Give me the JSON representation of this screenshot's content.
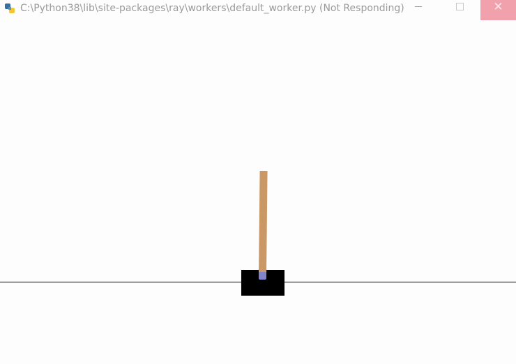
{
  "window": {
    "title": "C:\\Python38\\lib\\site-packages\\ray\\workers\\default_worker.py (Not Responding)",
    "app_icon": "python-icon",
    "controls": {
      "minimize_icon": "minimize-icon",
      "maximize_icon": "maximize-icon",
      "close_icon": "close-icon",
      "close_glyph": "✕"
    }
  },
  "scene": {
    "name": "cartpole",
    "colors": {
      "background": "#fdfdfd",
      "track": "#000000",
      "cart": "#000000",
      "pole": "#ca9865",
      "axle": "#8184cb",
      "close_button": "#f1a1ac"
    }
  }
}
